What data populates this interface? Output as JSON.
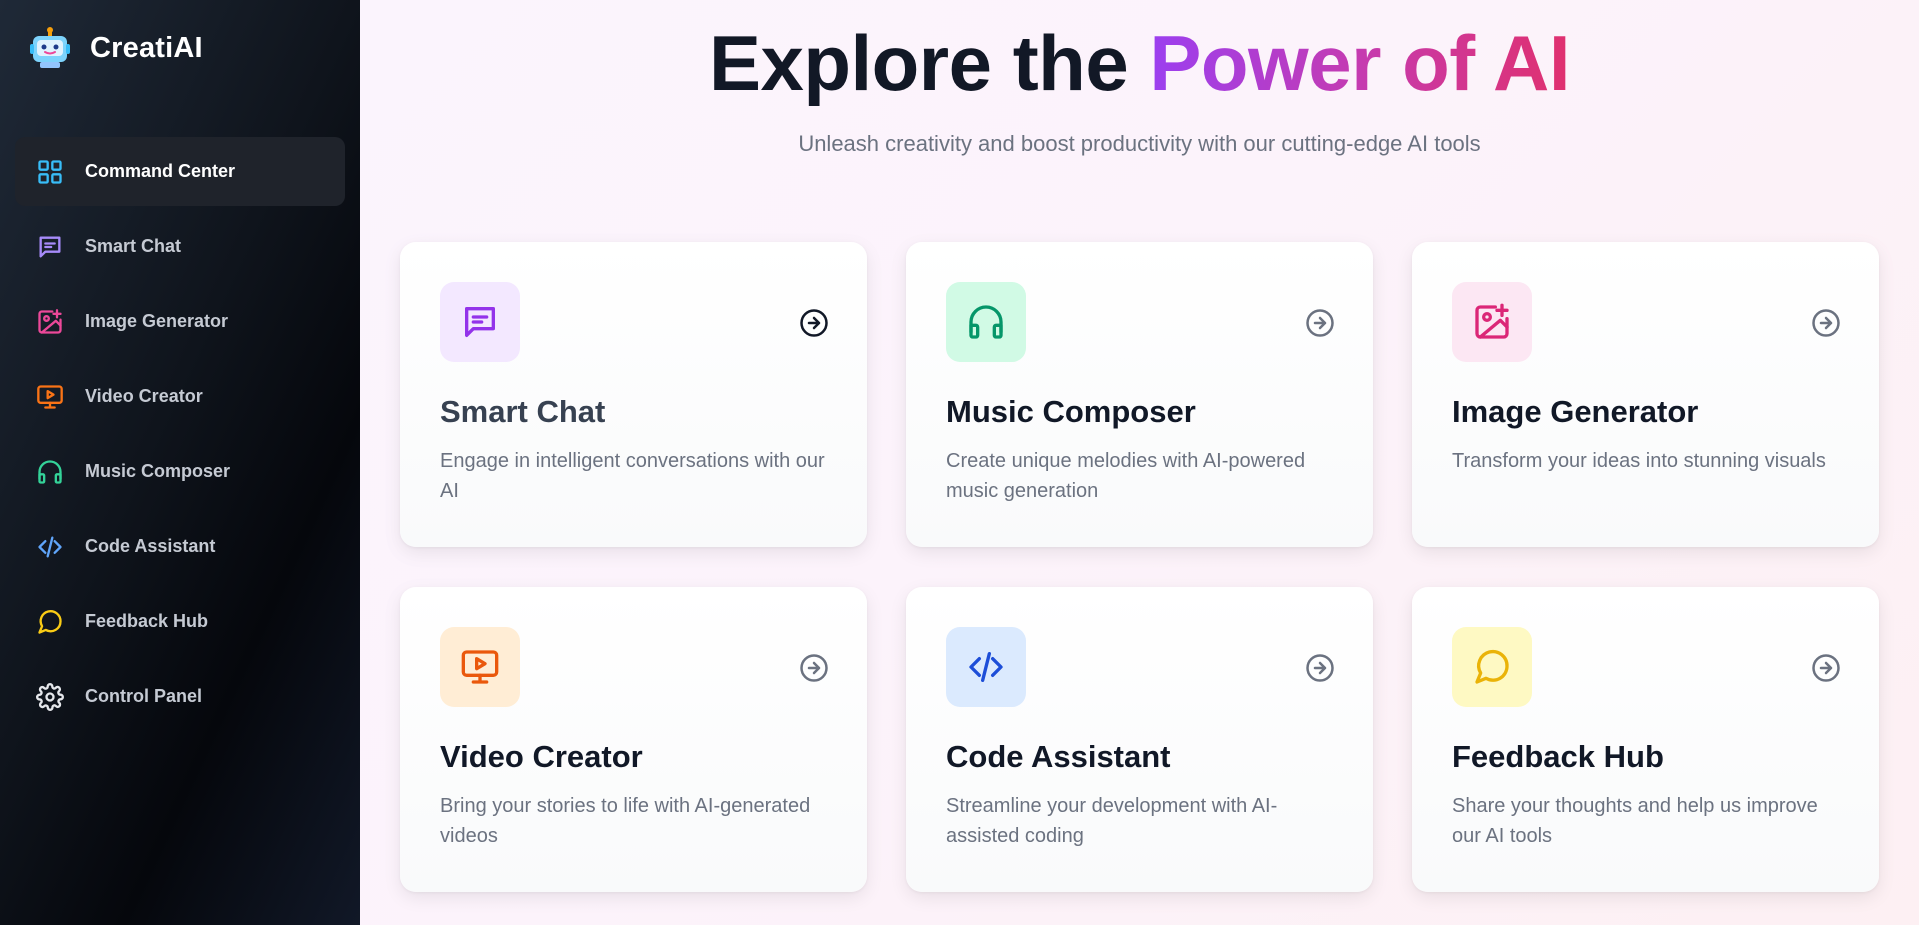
{
  "brand": {
    "name": "CreatiAI"
  },
  "sidebar": {
    "items": [
      {
        "label": "Command Center",
        "icon": "grid-icon",
        "color": "#38bdf8",
        "active": true
      },
      {
        "label": "Smart Chat",
        "icon": "chat-icon",
        "color": "#a78bfa"
      },
      {
        "label": "Image Generator",
        "icon": "image-plus-icon",
        "color": "#ec4899"
      },
      {
        "label": "Video Creator",
        "icon": "monitor-play-icon",
        "color": "#f97316"
      },
      {
        "label": "Music Composer",
        "icon": "headphones-icon",
        "color": "#34d399"
      },
      {
        "label": "Code Assistant",
        "icon": "code-icon",
        "color": "#60a5fa"
      },
      {
        "label": "Feedback Hub",
        "icon": "message-circle-icon",
        "color": "#facc15"
      },
      {
        "label": "Control Panel",
        "icon": "gear-icon",
        "color": "#e5e7eb"
      }
    ]
  },
  "hero": {
    "title_main": "Explore the ",
    "title_accent": "Power of AI",
    "subtitle": "Unleash creativity and boost productivity with our cutting-edge AI tools"
  },
  "cards": [
    {
      "title": "Smart Chat",
      "description": "Engage in intelligent conversations with our AI",
      "icon": "chat-icon",
      "color": "#9333ea",
      "bg": "#f3e8ff"
    },
    {
      "title": "Music Composer",
      "description": "Create unique melodies with AI-powered music generation",
      "icon": "headphones-icon",
      "color": "#059669",
      "bg": "#d1fae5"
    },
    {
      "title": "Image Generator",
      "description": "Transform your ideas into stunning visuals",
      "icon": "image-plus-icon",
      "color": "#db2777",
      "bg": "#fce7f3"
    },
    {
      "title": "Video Creator",
      "description": "Bring your stories to life with AI-generated videos",
      "icon": "monitor-play-icon",
      "color": "#ea580c",
      "bg": "#ffedd5"
    },
    {
      "title": "Code Assistant",
      "description": "Streamline your development with AI-assisted coding",
      "icon": "code-icon",
      "color": "#1d4ed8",
      "bg": "#dbeafe"
    },
    {
      "title": "Feedback Hub",
      "description": "Share your thoughts and help us improve our AI tools",
      "icon": "message-circle-icon",
      "color": "#eab308",
      "bg": "#fef9c3"
    }
  ]
}
